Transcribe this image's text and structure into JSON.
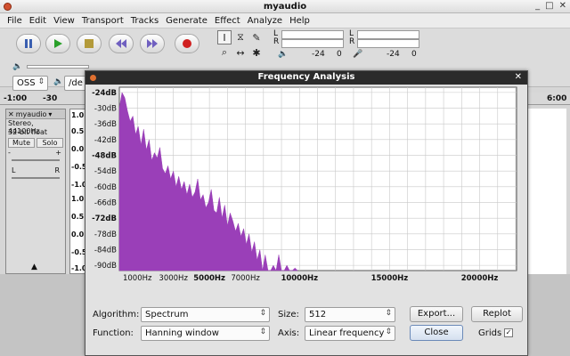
{
  "window": {
    "title": "myaudio",
    "controls": [
      "_",
      "□",
      "✕"
    ]
  },
  "menubar": [
    "File",
    "Edit",
    "View",
    "Transport",
    "Tracks",
    "Generate",
    "Effect",
    "Analyze",
    "Help"
  ],
  "meters": {
    "rec_l": "L",
    "rec_r": "R",
    "play_l": "L",
    "play_r": "R",
    "out_db": "-24",
    "out_zero": "0",
    "in_db": "-24",
    "in_zero": "0"
  },
  "device": {
    "host": "OSS",
    "device_prefix": "/de"
  },
  "ruler": [
    "-1:00",
    "-30",
    "6:00"
  ],
  "track": {
    "name": "myaudio",
    "info1": "Stereo, 44100Hz",
    "info2": "32-bit float",
    "mute": "Mute",
    "solo": "Solo",
    "gain_minus": "-",
    "gain_plus": "+",
    "pan_l": "L",
    "pan_r": "R",
    "scale": [
      "1.0",
      "0.5",
      "0.0",
      "-0.5",
      "-1.0",
      "1.0",
      "0.5",
      "0.0",
      "-0.5",
      "-1.0"
    ]
  },
  "dialog": {
    "title": "Frequency Analysis",
    "close_glyph": "✕",
    "algorithm_label": "Algorithm:",
    "algorithm_value": "Spectrum",
    "size_label": "Size:",
    "size_value": "512",
    "function_label": "Function:",
    "function_value": "Hanning window",
    "axis_label": "Axis:",
    "axis_value": "Linear frequency",
    "export_button": "Export...",
    "replot_button": "Replot",
    "close_button": "Close",
    "grids_label": "Grids",
    "grids_checked": true
  },
  "chart_data": {
    "type": "area",
    "y_ticks": [
      "-24dB",
      "-30dB",
      "-36dB",
      "-42dB",
      "-48dB",
      "-54dB",
      "-60dB",
      "-66dB",
      "-72dB",
      "-78dB",
      "-84dB",
      "-90dB"
    ],
    "y_ticks_bold": [
      "-24dB",
      "-48dB",
      "-72dB"
    ],
    "x_ticks": [
      "1000Hz",
      "3000Hz",
      "5000Hz",
      "7000Hz",
      "10000Hz",
      "15000Hz",
      "20000Hz"
    ],
    "x_ticks_bold": [
      "5000Hz",
      "10000Hz",
      "15000Hz",
      "20000Hz"
    ],
    "xlim": [
      0,
      22050
    ],
    "ylim": [
      -92,
      -22
    ],
    "fill_color": "#9a3fb8",
    "x": [
      0,
      150,
      300,
      450,
      600,
      750,
      900,
      1050,
      1200,
      1350,
      1500,
      1650,
      1800,
      1950,
      2100,
      2250,
      2400,
      2550,
      2700,
      2850,
      3000,
      3150,
      3300,
      3450,
      3600,
      3750,
      3900,
      4050,
      4200,
      4350,
      4500,
      4650,
      4800,
      4950,
      5100,
      5250,
      5400,
      5550,
      5700,
      5850,
      6000,
      6150,
      6300,
      6450,
      6600,
      6750,
      6900,
      7050,
      7200,
      7350,
      7500,
      7650,
      7800,
      7950,
      8100,
      8250,
      8400,
      8550,
      8700,
      8850,
      9000,
      9150,
      9300,
      9450,
      9600,
      9750,
      9900
    ],
    "values": [
      -30,
      -24,
      -26,
      -31,
      -35,
      -33,
      -40,
      -37,
      -44,
      -38,
      -46,
      -42,
      -50,
      -47,
      -49,
      -45,
      -53,
      -55,
      -52,
      -57,
      -54,
      -60,
      -56,
      -61,
      -58,
      -63,
      -59,
      -64,
      -62,
      -57,
      -65,
      -63,
      -68,
      -66,
      -61,
      -69,
      -70,
      -64,
      -72,
      -67,
      -75,
      -70,
      -73,
      -77,
      -74,
      -79,
      -76,
      -82,
      -78,
      -85,
      -81,
      -88,
      -84,
      -92,
      -86,
      -92,
      -92,
      -90,
      -92,
      -86,
      -92,
      -92,
      -90,
      -92,
      -92,
      -91,
      -92
    ]
  }
}
